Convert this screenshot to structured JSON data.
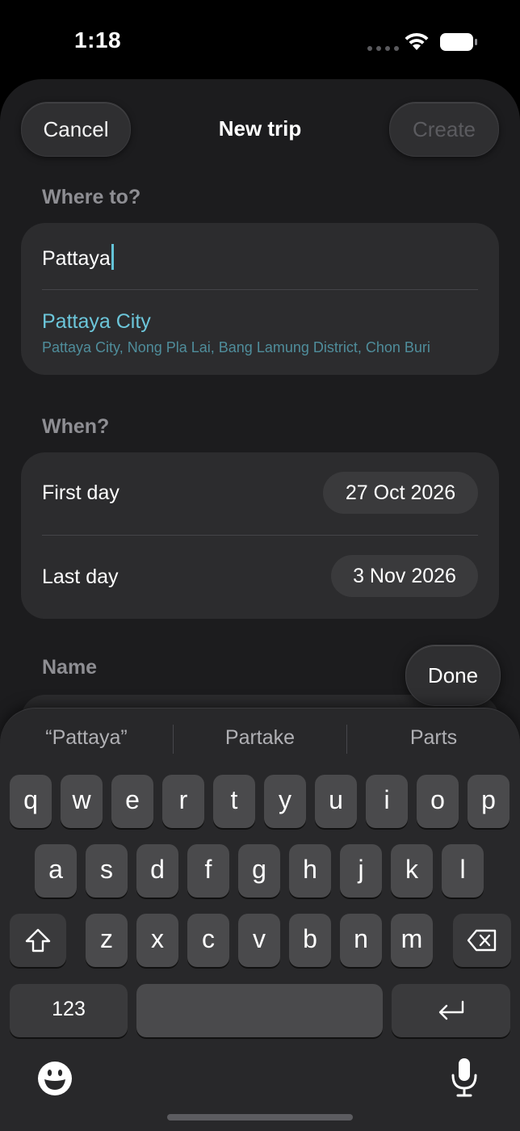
{
  "status_bar": {
    "time": "1:18"
  },
  "header": {
    "title": "New trip",
    "cancel_label": "Cancel",
    "create_label": "Create"
  },
  "where": {
    "label": "Where to?",
    "input_value": "Pattaya",
    "suggestion": {
      "title": "Pattaya City",
      "subtitle": "Pattaya City, Nong Pla Lai, Bang Lamung District, Chon Buri"
    }
  },
  "when": {
    "label": "When?",
    "first_day_label": "First day",
    "first_day_value": "27 Oct 2026",
    "last_day_label": "Last day",
    "last_day_value": "3 Nov 2026"
  },
  "name_section": {
    "label": "Name"
  },
  "done_label": "Done",
  "keyboard": {
    "suggestions": [
      "“Pattaya”",
      "Partake",
      "Parts"
    ],
    "row1": [
      "q",
      "w",
      "e",
      "r",
      "t",
      "y",
      "u",
      "i",
      "o",
      "p"
    ],
    "row2": [
      "a",
      "s",
      "d",
      "f",
      "g",
      "h",
      "j",
      "k",
      "l"
    ],
    "row3": [
      "z",
      "x",
      "c",
      "v",
      "b",
      "n",
      "m"
    ],
    "numbers_label": "123",
    "icons": {
      "shift": "shift-icon",
      "delete": "delete-icon",
      "return": "return-icon",
      "emoji": "emoji-icon",
      "mic": "microphone-icon"
    }
  },
  "colors": {
    "accent": "#6cc6da",
    "sheet_bg": "#1c1c1e",
    "card_bg": "#2c2c2e"
  }
}
